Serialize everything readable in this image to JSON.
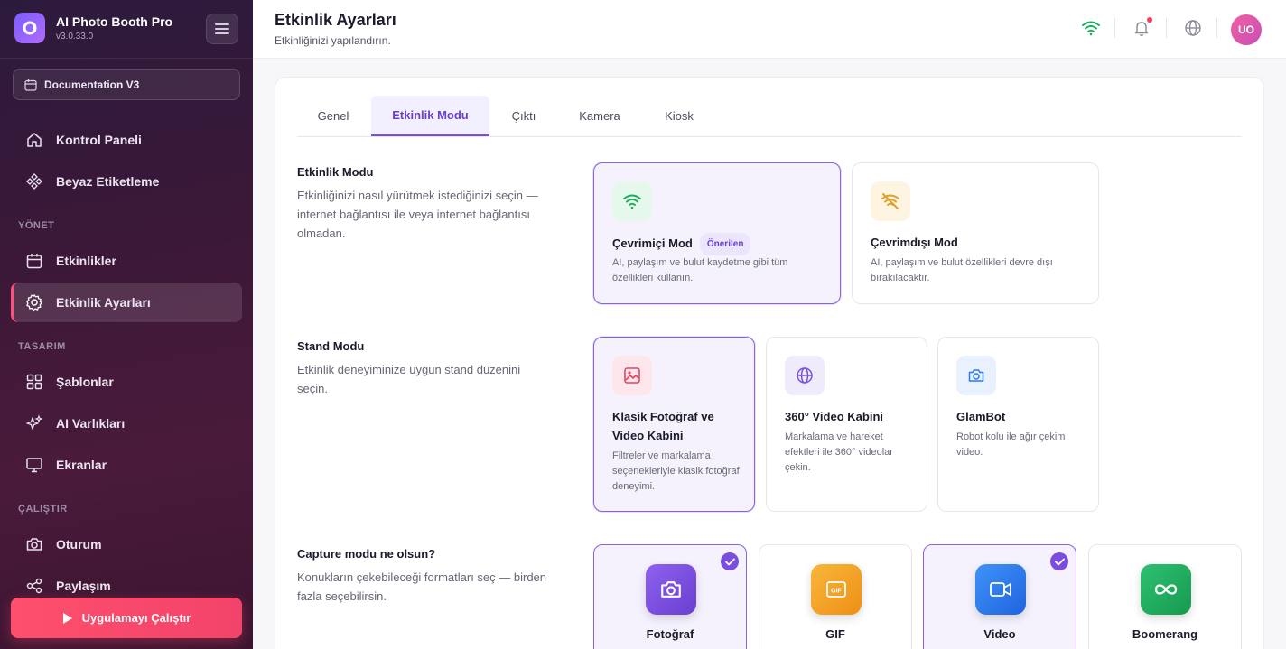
{
  "app": {
    "title": "AI Photo Booth Pro",
    "version": "v3.0.33.0"
  },
  "sidebar": {
    "workspace": "Documentation V3",
    "items_top": [
      {
        "label": "Kontrol Paneli",
        "icon": "home-icon"
      },
      {
        "label": "Beyaz Etiketleme",
        "icon": "palette-icon"
      }
    ],
    "section_manage": "YÖNET",
    "items_manage": [
      {
        "label": "Etkinlikler",
        "icon": "calendar-icon"
      },
      {
        "label": "Etkinlik Ayarları",
        "icon": "gear-icon",
        "active": true
      }
    ],
    "section_design": "TASARIM",
    "items_design": [
      {
        "label": "Şablonlar",
        "icon": "grid-icon"
      },
      {
        "label": "AI Varlıkları",
        "icon": "sparkle-icon"
      },
      {
        "label": "Ekranlar",
        "icon": "monitor-icon"
      }
    ],
    "section_run": "ÇALIŞTIR",
    "items_run": [
      {
        "label": "Oturum",
        "icon": "camera-icon"
      },
      {
        "label": "Paylaşım",
        "icon": "share-icon"
      }
    ],
    "run_button": "Uygulamayı Çalıştır"
  },
  "header": {
    "title": "Etkinlik Ayarları",
    "subtitle": "Etkinliğinizi yapılandırın.",
    "avatar_initials": "UO"
  },
  "tabs": [
    {
      "label": "Genel"
    },
    {
      "label": "Etkinlik Modu",
      "active": true
    },
    {
      "label": "Çıktı"
    },
    {
      "label": "Kamera"
    },
    {
      "label": "Kiosk"
    }
  ],
  "event_mode": {
    "title": "Etkinlik Modu",
    "description": "Etkinliğinizi nasıl yürütmek istediğinizi seçin — internet bağlantısı ile veya internet bağlantısı olmadan.",
    "options": [
      {
        "title": "Çevrimiçi Mod",
        "badge": "Önerilen",
        "description": "AI, paylaşım ve bulut kaydetme gibi tüm özellikleri kullanın.",
        "selected": true
      },
      {
        "title": "Çevrimdışı Mod",
        "description": "AI, paylaşım ve bulut özellikleri devre dışı bırakılacaktır.",
        "selected": false
      }
    ]
  },
  "stand_mode": {
    "title": "Stand Modu",
    "description": "Etkinlik deneyiminize uygun stand düzenini seçin.",
    "options": [
      {
        "title": "Klasik Fotoğraf ve Video Kabini",
        "description": "Filtreler ve markalama seçenekleriyle klasik fotoğraf deneyimi.",
        "selected": true
      },
      {
        "title": "360° Video Kabini",
        "description": "Markalama ve hareket efektleri ile 360° videolar çekin.",
        "selected": false
      },
      {
        "title": "GlamBot",
        "description": "Robot kolu ile ağır çekim video.",
        "selected": false
      }
    ]
  },
  "capture_mode": {
    "title": "Capture modu ne olsun?",
    "description": "Konukların çekebileceği formatları seç — birden fazla seçebilirsin.",
    "options": [
      {
        "label": "Fotoğraf",
        "selected": true,
        "color": "#7a4de0"
      },
      {
        "label": "GIF",
        "selected": false,
        "color": "#f5a623"
      },
      {
        "label": "Video",
        "selected": true,
        "color": "#2b7cf0"
      },
      {
        "label": "Boomerang",
        "selected": false,
        "color": "#1fae5e"
      }
    ]
  }
}
